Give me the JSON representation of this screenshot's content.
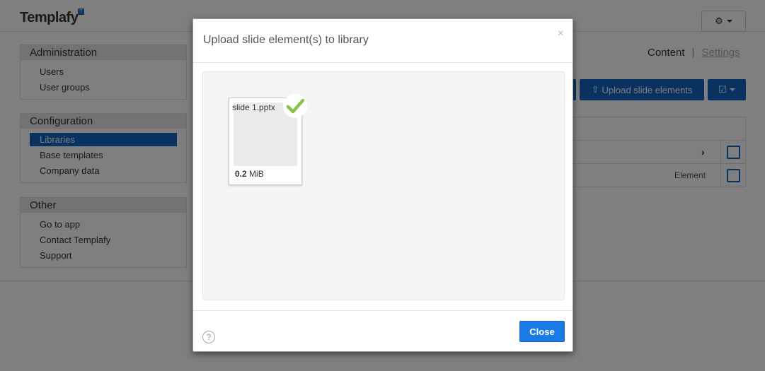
{
  "app": {
    "logo": "Templafy",
    "logo_badge": "T",
    "gear_icon": "⚙"
  },
  "sidebar": {
    "sections": [
      {
        "title": "Administration",
        "items": [
          "Users",
          "User groups"
        ]
      },
      {
        "title": "Configuration",
        "items": [
          "Libraries",
          "Base templates",
          "Company data"
        ],
        "active": "Libraries"
      },
      {
        "title": "Other",
        "items": [
          "Go to app",
          "Contact Templafy",
          "Support"
        ]
      }
    ]
  },
  "header_links": {
    "content": "Content",
    "separator": "|",
    "settings": "Settings"
  },
  "toolbar": {
    "upload_label": "Upload slide elements",
    "upload_icon": "⇧"
  },
  "table": {
    "rows": [
      {
        "label": "",
        "chevron": "›"
      },
      {
        "label": "Element",
        "chevron": ""
      }
    ]
  },
  "modal": {
    "title": "Upload slide element(s) to library",
    "close_glyph": "×",
    "file": {
      "name": "slide 1.pptx",
      "size_value": "0.2",
      "size_unit": "MiB",
      "status": "uploaded"
    },
    "help_glyph": "?",
    "close_button_label": "Close"
  },
  "colors": {
    "primary": "#1565c0",
    "close_button": "#1a7ae6",
    "success": "#8bc34a"
  }
}
